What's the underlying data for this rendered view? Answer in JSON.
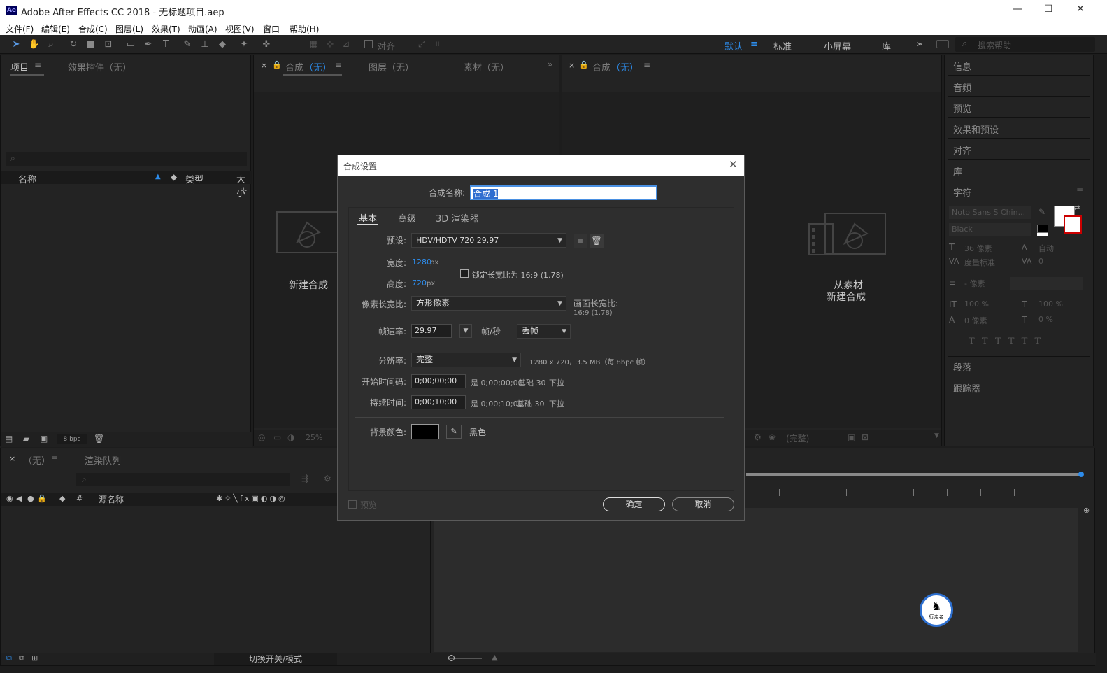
{
  "app": {
    "logo": "Ae",
    "title": "Adobe After Effects CC 2018 - 无标题项目.aep"
  },
  "window_controls": {
    "minimize": "—",
    "maximize": "☐",
    "close": "✕"
  },
  "menu": [
    "文件(F)",
    "编辑(E)",
    "合成(C)",
    "图层(L)",
    "效果(T)",
    "动画(A)",
    "视图(V)",
    "窗口",
    "帮助(H)"
  ],
  "toolbar": {
    "align_label": "对齐",
    "workspaces": [
      "默认",
      "标准",
      "小屏幕",
      "库"
    ],
    "search_placeholder": "搜索帮助"
  },
  "project_panel": {
    "tab_project": "项目",
    "tab_effects": "效果控件（无）",
    "col_name": "名称",
    "col_type": "类型",
    "col_size": "大小",
    "bpc": "8 bpc"
  },
  "comp_panel_left": {
    "tab_comp": "合成",
    "tab_comp_none": "（无）",
    "tab_layer": "图层（无）",
    "tab_footage": "素材（无）",
    "new_comp": "新建合成",
    "zoom": "25%"
  },
  "comp_panel_right": {
    "tab_comp": "合成",
    "tab_comp_none": "（无）",
    "from_footage_line1": "从素材",
    "from_footage_line2": "新建合成",
    "quality": "(完整)"
  },
  "right_panel": {
    "items": [
      "信息",
      "音频",
      "预览",
      "效果和预设",
      "对齐",
      "库",
      "字符"
    ],
    "font": "Noto Sans S Chin...",
    "style": "Black",
    "size": "36 像素",
    "leading": "自动",
    "kerning": "度量标准",
    "tracking": "0",
    "stroke": "- 像素",
    "vscale": "100 %",
    "hscale": "100 %",
    "baseline": "0 像素",
    "tsume": "0 %",
    "paragraph": "段落",
    "tracker": "跟踪器"
  },
  "timeline": {
    "tab_none": "（无）",
    "tab_render": "渲染队列",
    "col_source": "源名称",
    "toggle": "切换开关/模式"
  },
  "dialog": {
    "title": "合成设置",
    "name_label": "合成名称:",
    "name_value": "合成 1",
    "tabs": [
      "基本",
      "高级",
      "3D 渲染器"
    ],
    "preset_label": "预设:",
    "preset_value": "HDV/HDTV 720 29.97",
    "width_label": "宽度:",
    "width_value": "1280",
    "width_unit": "px",
    "height_label": "高度:",
    "height_value": "720",
    "height_unit": "px",
    "lock_label": "锁定长宽比为 16:9 (1.78)",
    "par_label": "像素长宽比:",
    "par_value": "方形像素",
    "frame_ar_label": "画面长宽比:",
    "frame_ar_value": "16:9 (1.78)",
    "fps_label": "帧速率:",
    "fps_value": "29.97",
    "fps_unit": "帧/秒",
    "drop_value": "丢帧",
    "res_label": "分辨率:",
    "res_value": "完整",
    "res_info": "1280 x 720，3.5 MB（每 8bpc 帧）",
    "start_label": "开始时间码:",
    "start_value": "0;00;00;00",
    "start_info_is": "是 0;00;00;00",
    "start_info_base": "基础 30",
    "start_info_pull": "下拉",
    "dur_label": "持续时间:",
    "dur_value": "0;00;10;00",
    "dur_info_is": "是 0;00;10;00",
    "dur_info_base": "基础 30",
    "dur_info_pull": "下拉",
    "bg_label": "背景颜色:",
    "bg_name": "黑色",
    "bg_color": "#000000",
    "preview_label": "预览",
    "ok": "确定",
    "cancel": "取消"
  },
  "watermark": "行走名"
}
